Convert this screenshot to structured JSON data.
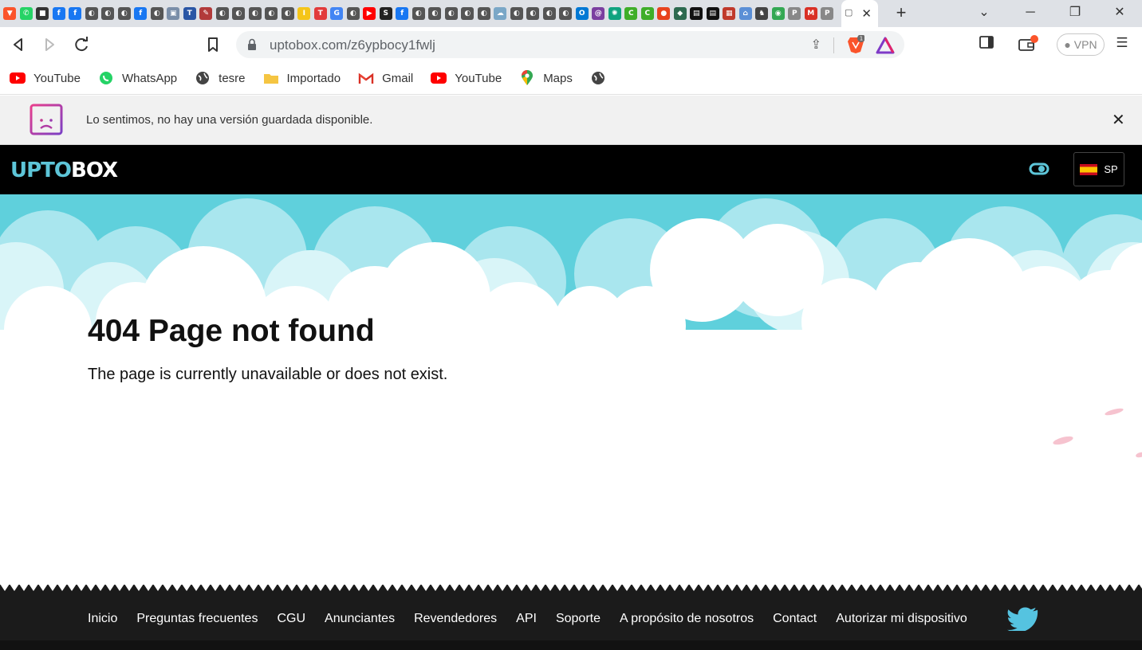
{
  "browser": {
    "tab_favicons": [
      {
        "icon": "brave-icon",
        "color": "#fb542b",
        "glyph": "▼"
      },
      {
        "icon": "whatsapp-icon",
        "color": "#25d366",
        "glyph": "✆"
      },
      {
        "icon": "bus-icon",
        "color": "#333333",
        "glyph": "■"
      },
      {
        "icon": "facebook-icon",
        "color": "#1877f2",
        "glyph": "f"
      },
      {
        "icon": "facebook-icon",
        "color": "#1877f2",
        "glyph": "f"
      },
      {
        "icon": "globe-icon",
        "color": "#555555",
        "glyph": "◐"
      },
      {
        "icon": "globe-icon",
        "color": "#555555",
        "glyph": "◐"
      },
      {
        "icon": "globe-icon",
        "color": "#555555",
        "glyph": "◐"
      },
      {
        "icon": "facebook-icon",
        "color": "#1877f2",
        "glyph": "f"
      },
      {
        "icon": "globe-icon",
        "color": "#555555",
        "glyph": "◐"
      },
      {
        "icon": "shield-icon",
        "color": "#7a8ea8",
        "glyph": "▣"
      },
      {
        "icon": "tmc-icon",
        "color": "#2a56a5",
        "glyph": "T"
      },
      {
        "icon": "pen-icon",
        "color": "#b23a3a",
        "glyph": "✎"
      },
      {
        "icon": "globe-icon",
        "color": "#555555",
        "glyph": "◐"
      },
      {
        "icon": "globe-icon",
        "color": "#555555",
        "glyph": "◐"
      },
      {
        "icon": "globe-icon",
        "color": "#555555",
        "glyph": "◐"
      },
      {
        "icon": "globe-icon",
        "color": "#555555",
        "glyph": "◐"
      },
      {
        "icon": "globe-icon",
        "color": "#555555",
        "glyph": "◐"
      },
      {
        "icon": "imdb-icon",
        "color": "#f5c518",
        "glyph": "I"
      },
      {
        "icon": "tmx-icon",
        "color": "#e23b3b",
        "glyph": "T"
      },
      {
        "icon": "google-icon",
        "color": "#4285f4",
        "glyph": "G"
      },
      {
        "icon": "globe-icon",
        "color": "#555555",
        "glyph": "◐"
      },
      {
        "icon": "youtube-icon",
        "color": "#ff0000",
        "glyph": "▶"
      },
      {
        "icon": "sbi-icon",
        "color": "#222222",
        "glyph": "S"
      },
      {
        "icon": "facebook-icon",
        "color": "#1877f2",
        "glyph": "f"
      },
      {
        "icon": "globe-icon",
        "color": "#555555",
        "glyph": "◐"
      },
      {
        "icon": "globe-icon",
        "color": "#555555",
        "glyph": "◐"
      },
      {
        "icon": "globe-icon",
        "color": "#555555",
        "glyph": "◐"
      },
      {
        "icon": "globe-icon",
        "color": "#555555",
        "glyph": "◐"
      },
      {
        "icon": "globe-icon",
        "color": "#555555",
        "glyph": "◐"
      },
      {
        "icon": "cloud-icon",
        "color": "#7aa7c7",
        "glyph": "☁"
      },
      {
        "icon": "globe-icon",
        "color": "#555555",
        "glyph": "◐"
      },
      {
        "icon": "globe-icon",
        "color": "#555555",
        "glyph": "◐"
      },
      {
        "icon": "globe-icon",
        "color": "#555555",
        "glyph": "◐"
      },
      {
        "icon": "globe-icon",
        "color": "#555555",
        "glyph": "◐"
      },
      {
        "icon": "outlook-icon",
        "color": "#0078d4",
        "glyph": "O"
      },
      {
        "icon": "spiral-icon",
        "color": "#7b3fa0",
        "glyph": "@"
      },
      {
        "icon": "chatgpt-icon",
        "color": "#10a37f",
        "glyph": "✺"
      },
      {
        "icon": "c-icon",
        "color": "#3fae29",
        "glyph": "C"
      },
      {
        "icon": "c-icon",
        "color": "#3fae29",
        "glyph": "C"
      },
      {
        "icon": "tomato-icon",
        "color": "#e8431d",
        "glyph": "●"
      },
      {
        "icon": "shield-icon",
        "color": "#2d6a4f",
        "glyph": "◆"
      },
      {
        "icon": "film-icon",
        "color": "#111111",
        "glyph": "▤"
      },
      {
        "icon": "film-icon",
        "color": "#111111",
        "glyph": "▤"
      },
      {
        "icon": "clapper-icon",
        "color": "#c0392b",
        "glyph": "▦"
      },
      {
        "icon": "paper-icon",
        "color": "#5b8fd6",
        "glyph": "⌂"
      },
      {
        "icon": "chess-icon",
        "color": "#444444",
        "glyph": "♞"
      },
      {
        "icon": "maps-icon",
        "color": "#34a853",
        "glyph": "◉"
      },
      {
        "icon": "tab-icon",
        "color": "#888888",
        "glyph": "P"
      },
      {
        "icon": "gmail-icon",
        "color": "#d93025",
        "glyph": "M"
      },
      {
        "icon": "tab-icon",
        "color": "#888888",
        "glyph": "P"
      }
    ],
    "close_tab": "✕",
    "new_tab": "+",
    "url": "uptobox.com/z6ypbocy1fwlj",
    "vpn_label": "VPN",
    "brave_badge": "1",
    "bookmarks": [
      {
        "label": "YouTube",
        "icon": "youtube-icon"
      },
      {
        "label": "WhatsApp",
        "icon": "whatsapp-icon"
      },
      {
        "label": "tesre",
        "icon": "globe-icon"
      },
      {
        "label": "Importado",
        "icon": "folder-icon"
      },
      {
        "label": "Gmail",
        "icon": "gmail-icon"
      },
      {
        "label": "YouTube",
        "icon": "youtube-icon"
      },
      {
        "label": "Maps",
        "icon": "maps-icon"
      }
    ]
  },
  "infobar": {
    "message": "Lo sentimos, no hay una versión guardada disponible."
  },
  "site": {
    "logo_part1": "UPTO",
    "logo_part2": "BOX",
    "lang_code": "SP",
    "title": "404 Page not found",
    "subtitle": "The page is currently unavailable or does not exist.",
    "footer_links": [
      "Inicio",
      "Preguntas frecuentes",
      "CGU",
      "Anunciantes",
      "Revendedores",
      "API",
      "Soporte",
      "A propósito de nosotros",
      "Contact",
      "Autorizar mi dispositivo"
    ]
  },
  "colors": {
    "sky": "#5fd0dc",
    "logo_accent": "#5dc5d8",
    "footer_bg": "#1b1b1b",
    "twitter": "#55c3e0"
  }
}
